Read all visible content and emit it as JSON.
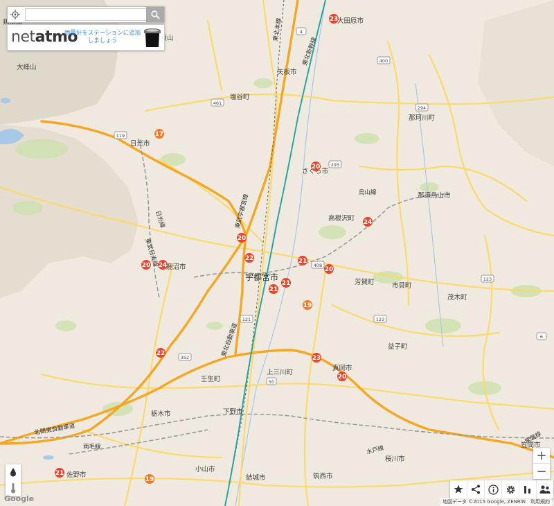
{
  "search": {
    "placeholder": ""
  },
  "promo": {
    "logo_light": "net",
    "logo_bold": "atmo",
    "text": "雨量計をステーションに追加しましょう"
  },
  "cities": [
    "宇都宮市",
    "日光市",
    "鹿沼市",
    "真岡市",
    "栃木市",
    "下野市",
    "小山市",
    "佐野市",
    "結城市",
    "筑西市",
    "桜川市",
    "笠間市",
    "上三川町",
    "壬生町",
    "芳賀町",
    "市貝町",
    "茂木町",
    "益子町",
    "那須烏山市",
    "那珂川町",
    "高根沢町",
    "さくら市",
    "矢板市",
    "塩谷町",
    "大田原市"
  ],
  "rail_labels": [
    "東北新幹線",
    "東北本線",
    "日光線",
    "東武日光線",
    "東武宇都宮線",
    "烏山線",
    "水戸線",
    "両毛線",
    "常磐線",
    "北関東自動車道",
    "東北自動車道"
  ],
  "other_labels": [
    "大峰山",
    "高原山",
    "鶏頂山"
  ],
  "routes": [
    "4",
    "119",
    "121",
    "123",
    "293",
    "294",
    "352",
    "400",
    "408",
    "461",
    "50",
    "6",
    "123"
  ],
  "markers": [
    "23",
    "17",
    "20",
    "24",
    "20",
    "22",
    "20",
    "24",
    "21",
    "21",
    "21",
    "20",
    "19",
    "22",
    "23",
    "20",
    "21",
    "19"
  ],
  "colors": {
    "marker": "#e8452c",
    "highway": "#f5a623",
    "road": "#fcd96b",
    "rail": "#9a9a9a",
    "shinkansen": "#2aa6a0",
    "land": "#efe9df",
    "forest": "#cfe2b0",
    "water": "#a8c8e8"
  },
  "zoom": {
    "in": "+",
    "out": "−"
  },
  "icons": {
    "locate": "crosshair-icon",
    "search": "magnifier-icon",
    "rain": "raindrop-icon",
    "temp": "thermometer-icon",
    "favorite": "star-icon",
    "share": "share-icon",
    "info": "info-icon",
    "settings": "gear-icon",
    "stats": "bars-icon",
    "users": "users-icon"
  },
  "google": "Google",
  "attribution": "地図データ ©2015 Google, ZENRIN　利用規約"
}
